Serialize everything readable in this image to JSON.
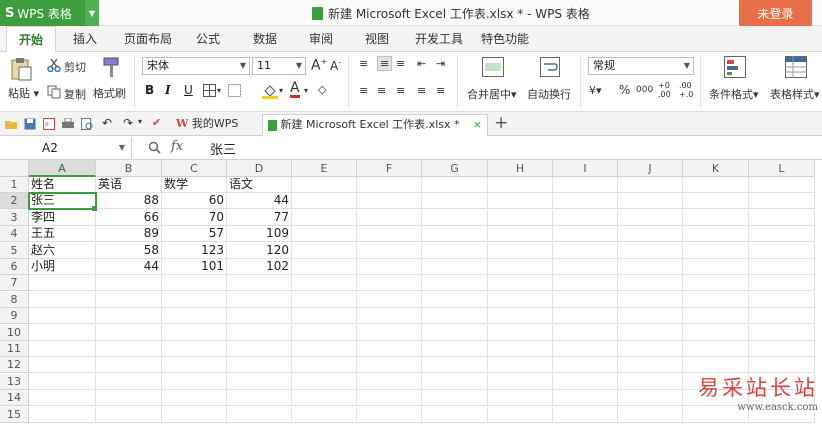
{
  "titlebar": {
    "app_name": "WPS 表格",
    "doc_title": "新建 Microsoft Excel 工作表.xlsx * - WPS 表格",
    "login": "未登录"
  },
  "menu": {
    "tabs": [
      "开始",
      "插入",
      "页面布局",
      "公式",
      "数据",
      "审阅",
      "视图",
      "开发工具",
      "特色功能"
    ]
  },
  "ribbon": {
    "paste": "粘贴",
    "cut": "剪切",
    "copy": "复制",
    "format_painter": "格式刷",
    "font_name": "宋体",
    "font_size": "11",
    "merge_center": "合并居中",
    "wrap_text": "自动换行",
    "number_format": "常规",
    "conditional_format": "条件格式",
    "table_style": "表格样式",
    "bold": "B",
    "italic": "I",
    "underline": "U",
    "percent": "%",
    "thousands": "000",
    "increase_decimal": "+0\n.00",
    "decrease_decimal": ".00\n+.0"
  },
  "doc_tabs": {
    "home_tab": "我的WPS",
    "file_tab": "新建 Microsoft Excel 工作表.xlsx *"
  },
  "formula_bar": {
    "name_box": "A2",
    "fx": "fx",
    "content": "张三"
  },
  "grid": {
    "columns": [
      "A",
      "B",
      "C",
      "D",
      "E",
      "F",
      "G",
      "H",
      "I",
      "J",
      "K",
      "L"
    ],
    "rows": [
      "1",
      "2",
      "3",
      "4",
      "5",
      "6",
      "7",
      "8",
      "9",
      "10",
      "11",
      "12",
      "13",
      "14",
      "15"
    ],
    "data": [
      [
        "姓名",
        "英语",
        "数学",
        "语文"
      ],
      [
        "张三",
        "88",
        "60",
        "44"
      ],
      [
        "李四",
        "66",
        "70",
        "77"
      ],
      [
        "王五",
        "89",
        "57",
        "109"
      ],
      [
        "赵六",
        "58",
        "123",
        "120"
      ],
      [
        "小明",
        "44",
        "101",
        "102"
      ]
    ]
  },
  "watermark": {
    "text": "易采站长站",
    "url": "www.easck.com"
  },
  "colors": {
    "accent": "#3c9e3f",
    "login": "#e86f47"
  }
}
